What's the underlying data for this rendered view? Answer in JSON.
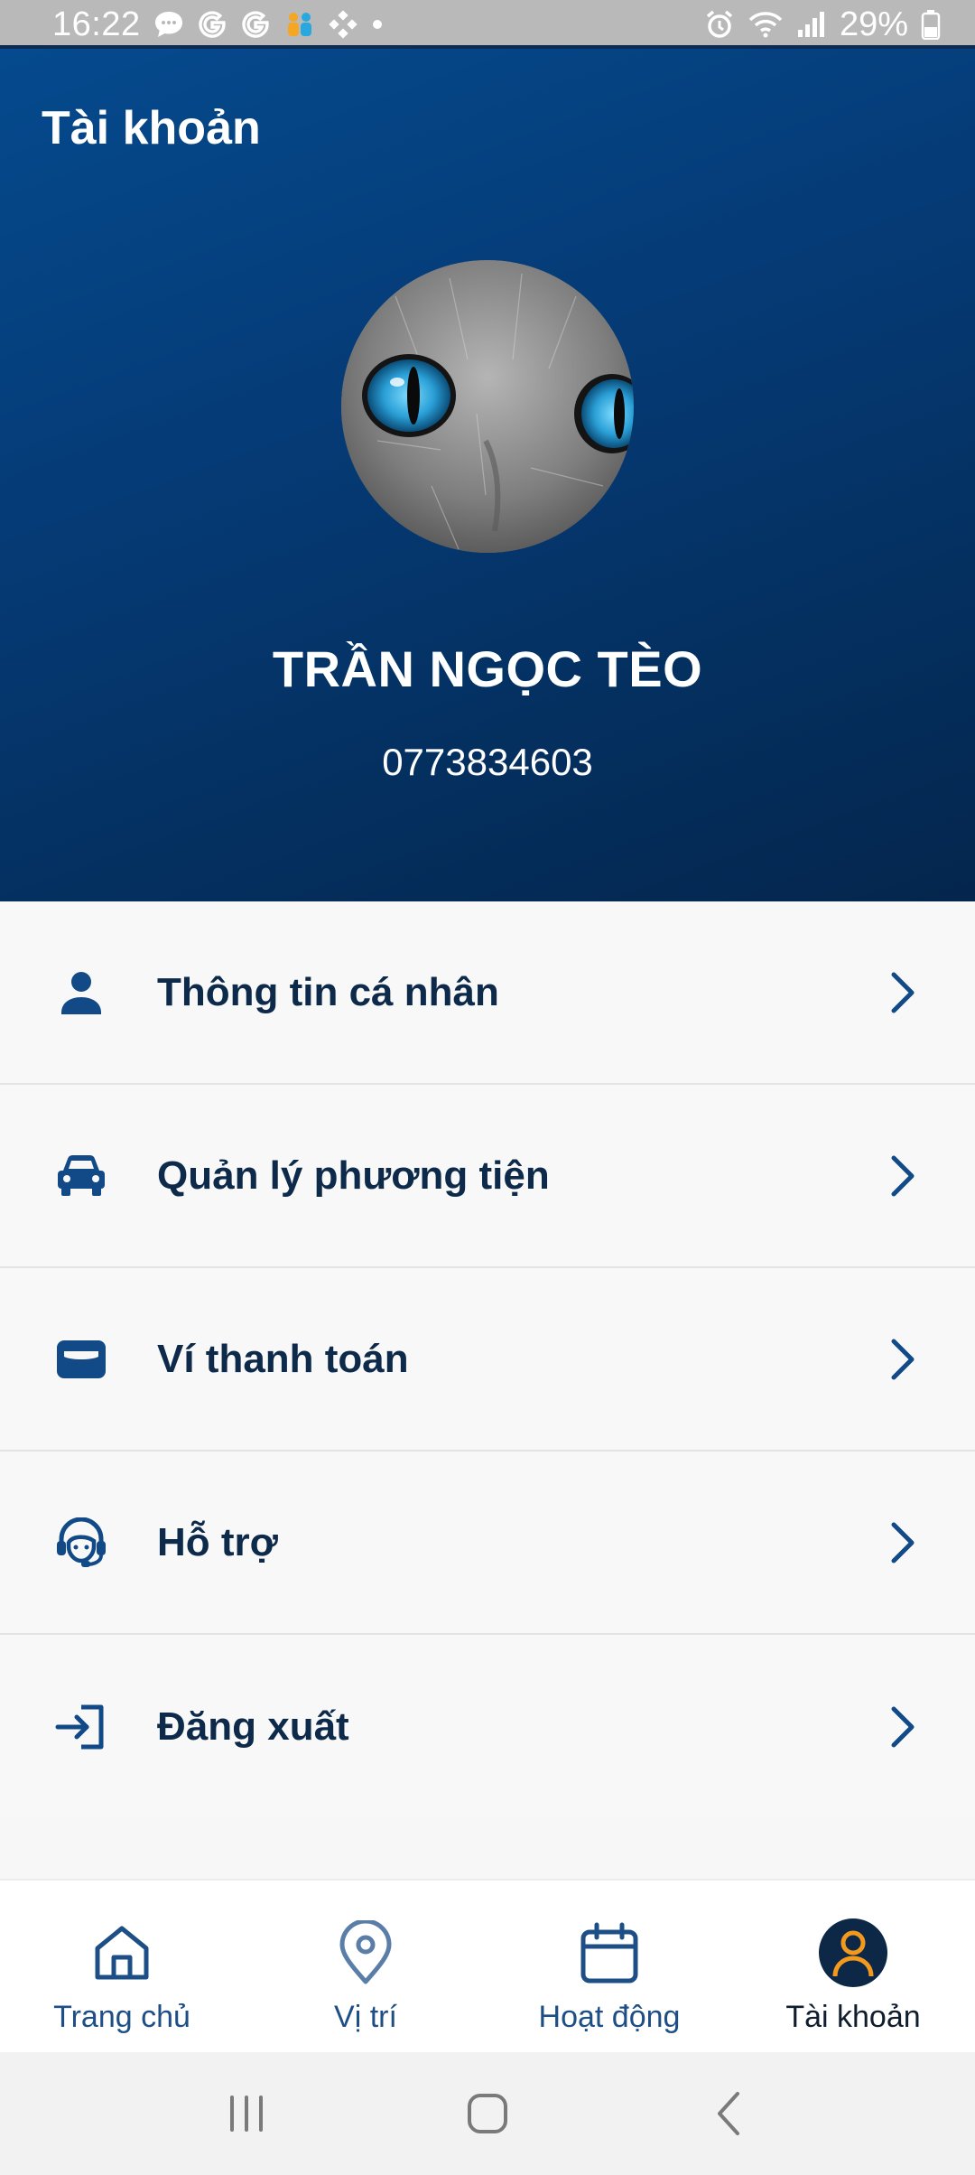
{
  "status_bar": {
    "time": "16:22",
    "battery": "29%",
    "icons_left": [
      "chat-bubble-icon",
      "google-icon",
      "google-icon",
      "people-icon",
      "dots-icon",
      "dot-icon"
    ],
    "icons_right": [
      "alarm-icon",
      "wifi-icon",
      "signal-icon",
      "battery-icon"
    ]
  },
  "header": {
    "title": "Tài khoản",
    "user_name": "TRẦN NGỌC TÈO",
    "phone": "0773834603",
    "colors": {
      "gradient_start": "#054a8e",
      "gradient_end": "#04264d"
    }
  },
  "menu": {
    "items": [
      {
        "label": "Thông tin cá nhân",
        "icon": "person-icon"
      },
      {
        "label": "Quản lý phương tiện",
        "icon": "car-icon"
      },
      {
        "label": "Ví thanh toán",
        "icon": "wallet-icon"
      },
      {
        "label": "Hỗ trợ",
        "icon": "support-agent-icon"
      },
      {
        "label": "Đăng xuất",
        "icon": "logout-icon"
      }
    ]
  },
  "bottom_nav": {
    "items": [
      {
        "label": "Trang chủ",
        "icon": "home-icon"
      },
      {
        "label": "Vị trí",
        "icon": "location-pin-icon"
      },
      {
        "label": "Hoạt động",
        "icon": "calendar-icon"
      },
      {
        "label": "Tài khoản",
        "icon": "account-icon",
        "active": true
      }
    ],
    "colors": {
      "inactive": "#1d4f86",
      "active_accent": "#f39a1e"
    }
  },
  "system_nav": {
    "buttons": [
      "recent-apps-icon",
      "home-button-icon",
      "back-icon"
    ]
  }
}
